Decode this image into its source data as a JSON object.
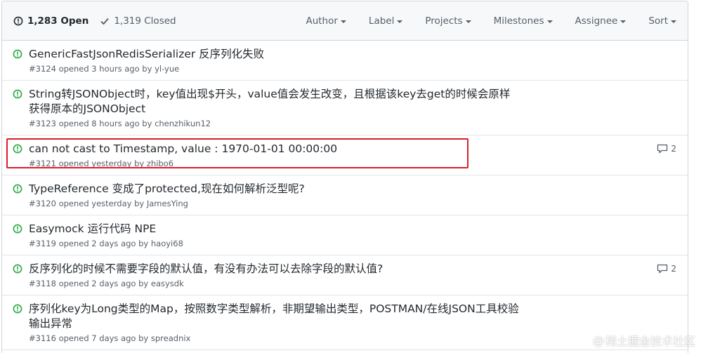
{
  "header": {
    "open_label": "1,283 Open",
    "closed_label": "1,319 Closed",
    "filters": [
      "Author",
      "Label",
      "Projects",
      "Milestones",
      "Assignee",
      "Sort"
    ]
  },
  "issues": [
    {
      "title": "GenericFastJsonRedisSerializer 反序列化失败",
      "number": "#3124",
      "opened": "opened 3 hours ago by",
      "author": "yl-yue",
      "comments": ""
    },
    {
      "title": "String转JSONObject时，key值出现$开头，value值会发生改变，且根据该key去get的时候会原样获得原本的JSONObject",
      "number": "#3123",
      "opened": "opened 8 hours ago by",
      "author": "chenzhikun12",
      "comments": ""
    },
    {
      "title": "can not cast to Timestamp, value : 1970-01-01 00:00:00",
      "number": "#3121",
      "opened": "opened yesterday by",
      "author": "zhibo6",
      "comments": "2"
    },
    {
      "title": "TypeReference 变成了protected,现在如何解析泛型呢?",
      "number": "#3120",
      "opened": "opened yesterday by",
      "author": "JamesYing",
      "comments": ""
    },
    {
      "title": "Easymock 运行代码 NPE",
      "number": "#3119",
      "opened": "opened 2 days ago by",
      "author": "haoyi68",
      "comments": ""
    },
    {
      "title": "反序列化的时候不需要字段的默认值，有没有办法可以去除字段的默认值?",
      "number": "#3118",
      "opened": "opened 2 days ago by",
      "author": "easysdk",
      "comments": "2"
    },
    {
      "title": "序列化key为Long类型的Map，按照数字类型解析，非期望输出类型，POSTMAN/在线JSON工具校验输出异常",
      "number": "#3116",
      "opened": "opened 7 days ago by",
      "author": "spreadnix",
      "comments": ""
    }
  ],
  "watermark": "稀土掘金技术社区",
  "colors": {
    "open_icon": "#28a745",
    "highlight": "#dc1e28",
    "header_bg": "#f6f8fa"
  }
}
